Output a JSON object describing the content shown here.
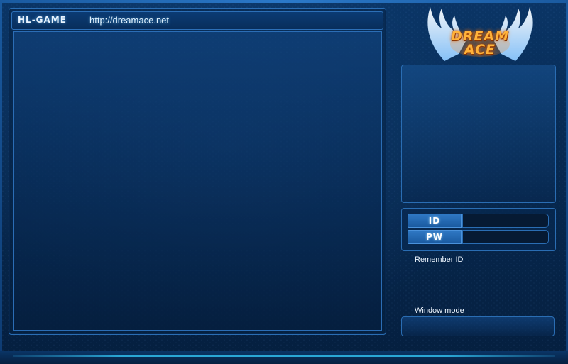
{
  "header": {
    "label": "HL-GAME",
    "url": "http://dreamace.net"
  },
  "logo": {
    "line1": "DREAM",
    "line2": "ACE",
    "icon": "winged-logo-icon"
  },
  "login": {
    "id_label": "ID",
    "id_value": "",
    "pw_label": "PW",
    "pw_value": ""
  },
  "options": {
    "remember_id_label": "Remember ID",
    "window_mode_label": "Window mode"
  },
  "colors": {
    "background": "#072a52",
    "accent": "#2a6db3",
    "logo": "#ffb23a",
    "bottom_line": "#2aa7d6"
  }
}
